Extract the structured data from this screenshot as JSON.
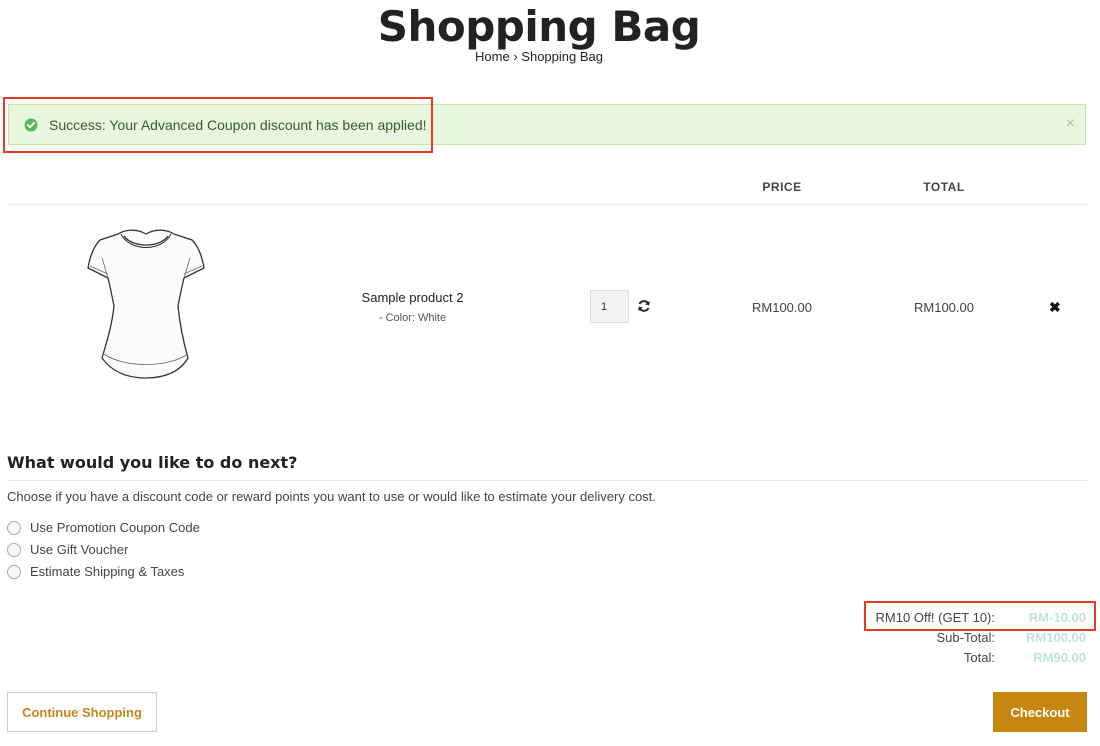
{
  "header": {
    "title": "Shopping Bag",
    "breadcrumb": {
      "home": "Home",
      "separator": "›",
      "current": "Shopping Bag"
    }
  },
  "alert": {
    "message": "Success: Your Advanced Coupon discount has been applied!",
    "close": "×"
  },
  "table": {
    "headers": {
      "price": "PRICE",
      "total": "TOTAL"
    },
    "rows": [
      {
        "name": "Sample product 2",
        "option": "- Color: White",
        "quantity": "1",
        "price": "RM100.00",
        "total": "RM100.00",
        "remove": "✖"
      }
    ]
  },
  "next": {
    "title": "What would you like to do next?",
    "description": "Choose if you have a discount code or reward points you want to use or would like to estimate your delivery cost.",
    "options": [
      "Use Promotion Coupon Code",
      "Use Gift Voucher",
      "Estimate Shipping & Taxes"
    ]
  },
  "summary": [
    {
      "label": "RM10 Off! (GET 10):",
      "value": "RM-10.00"
    },
    {
      "label": "Sub-Total:",
      "value": "RM100.00"
    },
    {
      "label": "Total:",
      "value": "RM90.00"
    }
  ],
  "buttons": {
    "continue": "Continue Shopping",
    "checkout": "Checkout"
  },
  "colors": {
    "accent": "#c9860f",
    "alert_bg": "#e7f6dc",
    "highlight": "#e33b22",
    "summary_value": "#bfe3e0"
  }
}
